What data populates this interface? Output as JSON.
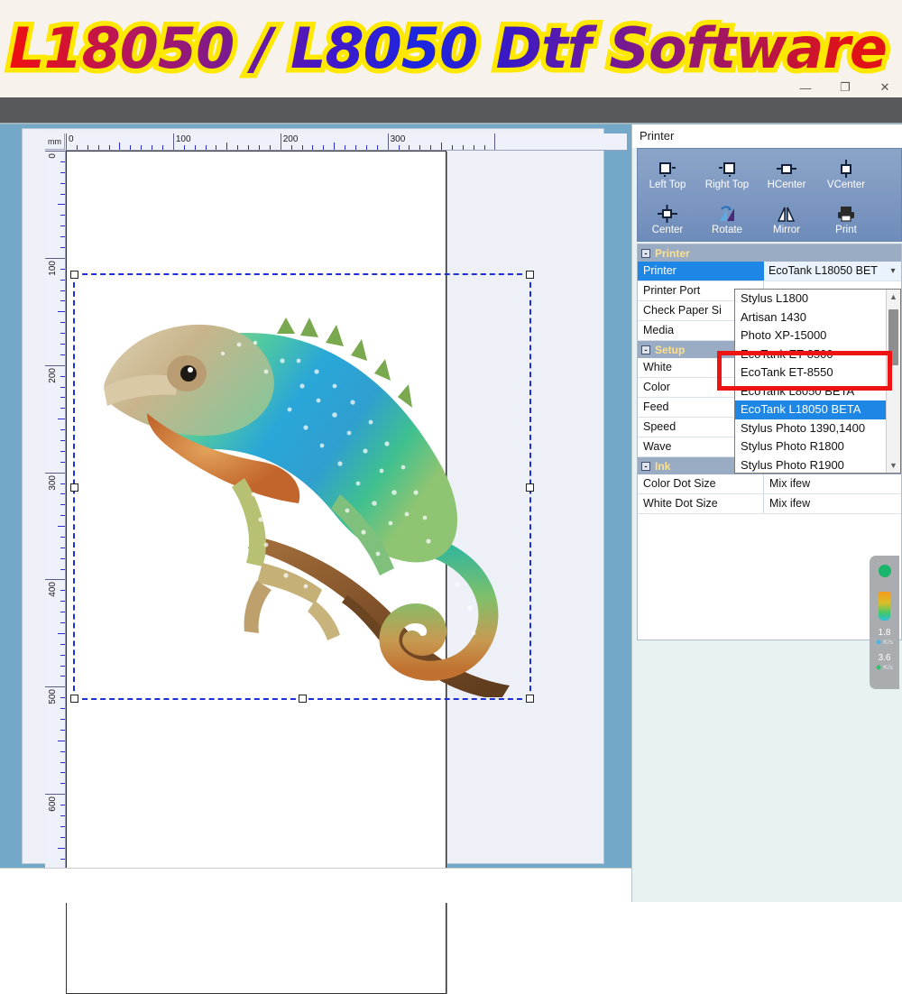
{
  "banner": {
    "text": "L18050 / L8050 Dtf Software",
    "bg_color": "#f7f3ec",
    "outline_color": "#ffe800"
  },
  "window_controls": {
    "minimize": "—",
    "maximize": "❐",
    "close": "✕"
  },
  "workspace": {
    "bg_color": "#74a8c8",
    "ruler_unit": "mm",
    "ruler_h_labels": [
      "0",
      "100",
      "200",
      "300"
    ],
    "ruler_v_labels": [
      "0",
      "100",
      "200",
      "300",
      "400",
      "500",
      "600"
    ],
    "artwork_name": "chameleon-on-branch"
  },
  "panel": {
    "title": "Printer",
    "toolbar": [
      {
        "label": "Left Top",
        "icon": "align-left-top-icon"
      },
      {
        "label": "Right Top",
        "icon": "align-right-top-icon"
      },
      {
        "label": "HCenter",
        "icon": "align-hcenter-icon"
      },
      {
        "label": "VCenter",
        "icon": "align-vcenter-icon"
      },
      {
        "label": "Center",
        "icon": "align-center-icon"
      },
      {
        "label": "Rotate",
        "icon": "rotate-icon"
      },
      {
        "label": "Mirror",
        "icon": "mirror-icon"
      },
      {
        "label": "Print",
        "icon": "print-icon"
      }
    ],
    "groups": [
      {
        "name": "Printer",
        "expander": "-",
        "rows": [
          {
            "name": "Printer",
            "value": "EcoTank L18050 BET",
            "selected": true,
            "combo": true
          },
          {
            "name": "Printer Port",
            "value": ""
          },
          {
            "name": "Check Paper Si",
            "value": ""
          },
          {
            "name": "Media",
            "value": ""
          }
        ]
      },
      {
        "name": "Setup",
        "expander": "-",
        "rows": [
          {
            "name": "White",
            "value": ""
          },
          {
            "name": "Color",
            "value": ""
          },
          {
            "name": "Feed",
            "value": ""
          },
          {
            "name": "Speed",
            "value": ""
          },
          {
            "name": "Wave",
            "value": ""
          }
        ]
      },
      {
        "name": "Ink",
        "expander": "-",
        "rows": [
          {
            "name": "Color Dot Size",
            "value": "Mix ifew"
          },
          {
            "name": "White Dot Size",
            "value": "Mix ifew"
          }
        ]
      }
    ],
    "dropdown": {
      "items": [
        {
          "label": "Stylus L1800",
          "selected": false
        },
        {
          "label": "Artisan 1430",
          "selected": false
        },
        {
          "label": "Photo XP-15000",
          "selected": false
        },
        {
          "label": "EcoTank ET-8500",
          "selected": false
        },
        {
          "label": "EcoTank ET-8550",
          "selected": false
        },
        {
          "label": "EcoTank L8050 BETA",
          "selected": false
        },
        {
          "label": "EcoTank L18050 BETA",
          "selected": true
        },
        {
          "label": "Stylus Photo 1390,1400",
          "selected": false
        },
        {
          "label": "Stylus Photo R1800",
          "selected": false
        },
        {
          "label": "Stylus Photo R1900",
          "selected": false
        }
      ],
      "scroll_up": "▲",
      "scroll_down": "▼",
      "highlight_color": "#ef1414"
    }
  },
  "speed_widget": {
    "status_color": "#19b56a",
    "upload_value": "1.8",
    "upload_unit": "K/s",
    "download_value": "3.6",
    "download_unit": "K/s"
  }
}
